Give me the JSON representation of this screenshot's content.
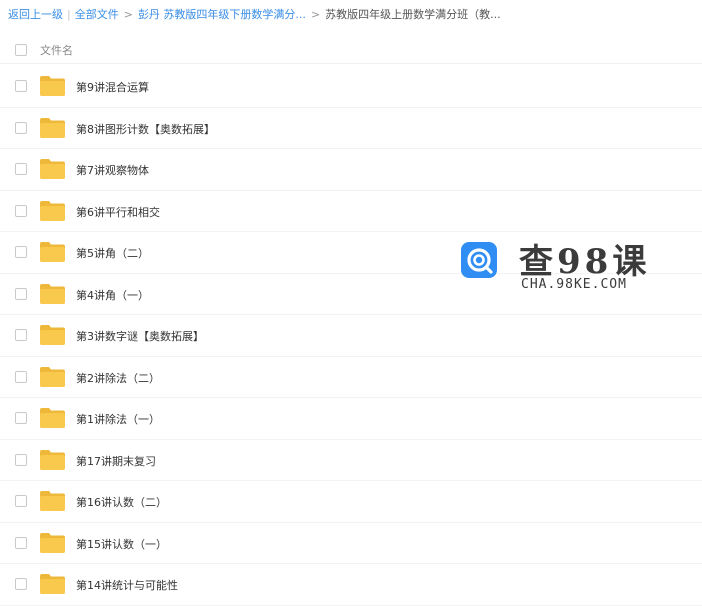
{
  "breadcrumb": {
    "back": "返回上一级",
    "all_files": "全部文件",
    "level1": "彭丹 苏教版四年级下册数学满分...",
    "current": "苏教版四年级上册数学满分班（教..."
  },
  "header": {
    "column_name": "文件名"
  },
  "files": [
    {
      "name": "第9讲混合运算"
    },
    {
      "name": "第8讲图形计数【奥数拓展】"
    },
    {
      "name": "第7讲观察物体"
    },
    {
      "name": "第6讲平行和相交"
    },
    {
      "name": "第5讲角（二）"
    },
    {
      "name": "第4讲角（一）"
    },
    {
      "name": "第3讲数字谜【奥数拓展】"
    },
    {
      "name": "第2讲除法（二）"
    },
    {
      "name": "第1讲除法（一）"
    },
    {
      "name": "第17讲期末复习"
    },
    {
      "name": "第16讲认数（二）"
    },
    {
      "name": "第15讲认数（一）"
    },
    {
      "name": "第14讲统计与可能性"
    }
  ],
  "watermark": {
    "title": "查98课",
    "subtitle": "CHA.98KE.COM"
  },
  "colors": {
    "link": "#3a8ee6",
    "folder": "#f8c94d",
    "folder_tab": "#eeb83a",
    "logo": "#2f8df3"
  },
  "icons": {
    "folder": "folder-icon",
    "logo": "search-logo-icon"
  }
}
